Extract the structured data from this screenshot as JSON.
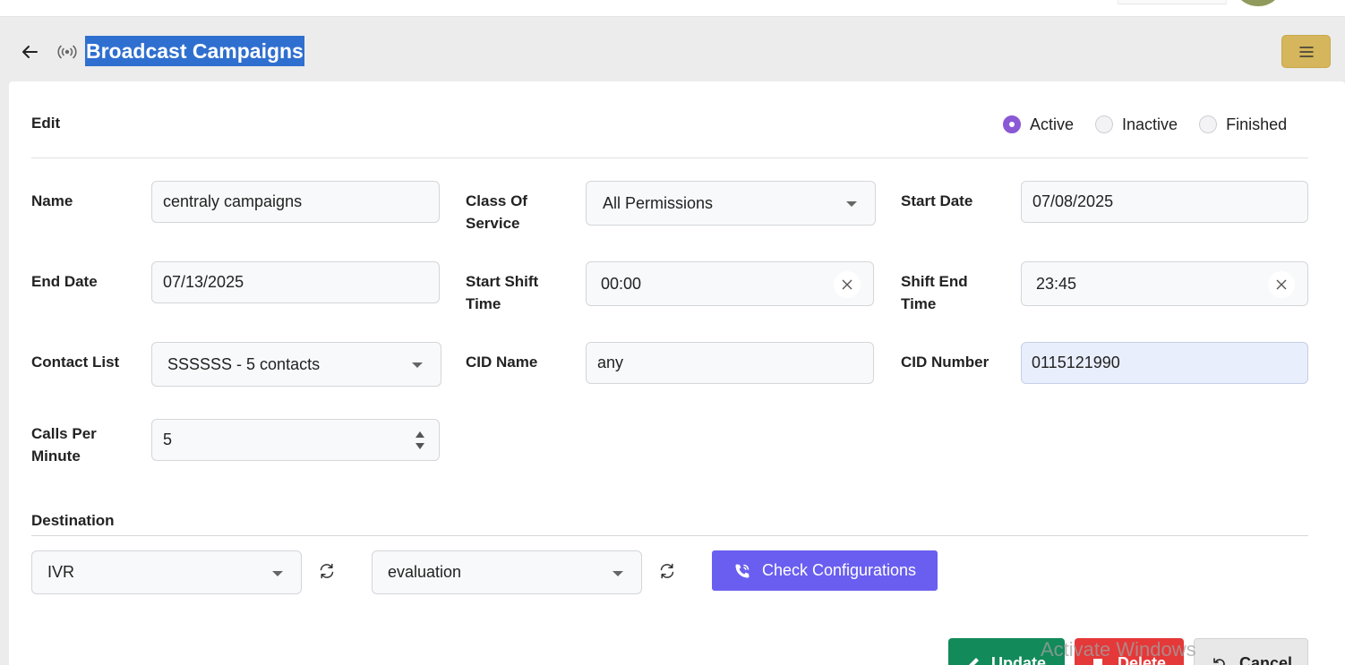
{
  "header": {
    "title": "Broadcast Campaigns"
  },
  "form": {
    "section_title": "Edit",
    "status": {
      "options": [
        "Active",
        "Inactive",
        "Finished"
      ],
      "selected": "Active"
    },
    "labels": {
      "name": "Name",
      "class_of_service": "Class Of Service",
      "start_date": "Start Date",
      "end_date": "End Date",
      "start_shift_time": "Start Shift Time",
      "shift_end_time": "Shift End Time",
      "contact_list": "Contact List",
      "cid_name": "CID Name",
      "cid_number": "CID Number",
      "calls_per_minute": "Calls Per Minute"
    },
    "values": {
      "name": "centraly campaigns",
      "class_of_service": "All Permissions",
      "start_date": "07/08/2025",
      "end_date": "07/13/2025",
      "start_shift_time": "00:00",
      "shift_end_time": "23:45",
      "contact_list": "SSSSSS - 5 contacts",
      "cid_name": "any",
      "cid_number": "0115121990",
      "calls_per_minute": "5"
    }
  },
  "destination": {
    "title": "Destination",
    "type_value": "IVR",
    "target_value": "evaluation",
    "check_button": "Check Configurations"
  },
  "actions": {
    "update": "Update",
    "delete": "Delete",
    "cancel": "Cancel"
  },
  "watermark": "Activate Windows",
  "colors": {
    "accent_purple": "#8a59d6",
    "check_button": "#6a5ef0",
    "update_button": "#138a5a",
    "delete_button": "#e53838",
    "menu_button": "#d5b65c",
    "title_highlight": "#2f6fd0"
  }
}
